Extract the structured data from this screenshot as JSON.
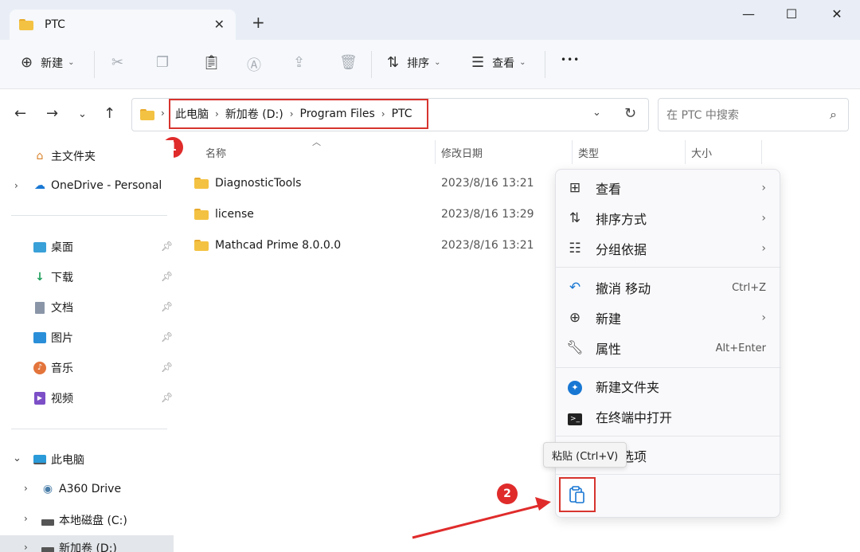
{
  "tab": {
    "title": "PTC",
    "close": "✕"
  },
  "window": {
    "minimize": "—",
    "maximize": "☐",
    "close": "✕",
    "new_tab": "+"
  },
  "toolbar": {
    "new_label": "新建",
    "sort_label": "排序",
    "view_label": "查看",
    "more": "•••"
  },
  "breadcrumb": [
    "此电脑",
    "新加卷 (D:)",
    "Program Files",
    "PTC"
  ],
  "search": {
    "placeholder": "在 PTC 中搜索"
  },
  "badges": {
    "one": "1",
    "two": "2"
  },
  "sidebar": {
    "home": "主文件夹",
    "onedrive": "OneDrive - Personal",
    "desktop": "桌面",
    "downloads": "下载",
    "documents": "文档",
    "pictures": "图片",
    "music": "音乐",
    "videos": "视频",
    "thispc": "此电脑",
    "a360": "A360 Drive",
    "cdrive": "本地磁盘 (C:)",
    "ddrive": "新加卷 (D:)"
  },
  "columns": {
    "name": "名称",
    "date": "修改日期",
    "type": "类型",
    "size": "大小"
  },
  "files": [
    {
      "name": "DiagnosticTools",
      "date": "2023/8/16 13:21"
    },
    {
      "name": "license",
      "date": "2023/8/16 13:29"
    },
    {
      "name": "Mathcad Prime 8.0.0.0",
      "date": "2023/8/16 13:21"
    }
  ],
  "context_menu": {
    "view": "查看",
    "sort": "排序方式",
    "group": "分组依据",
    "undo": "撤消 移动",
    "undo_shortcut": "Ctrl+Z",
    "new": "新建",
    "properties": "属性",
    "properties_shortcut": "Alt+Enter",
    "new_folder": "新建文件夹",
    "terminal": "在终端中打开",
    "more_options": "更多选项"
  },
  "tooltip": "粘贴 (Ctrl+V)",
  "colors": {
    "highlight": "#d7342e",
    "badge": "#e02b2b",
    "folder": "#f4c242"
  }
}
